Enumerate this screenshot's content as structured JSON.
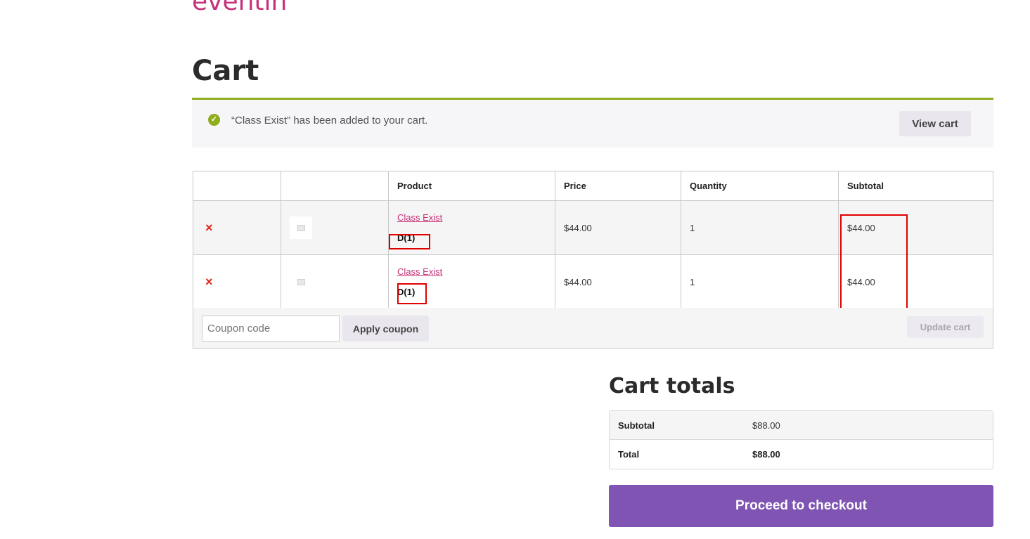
{
  "site": {
    "title": "eventin"
  },
  "page": {
    "title": "Cart"
  },
  "notice": {
    "message": "“Class Exist” has been added to your cart.",
    "view_cart_label": "View cart",
    "icon": "check-circle-icon",
    "accent_color": "#8fae1b"
  },
  "cart": {
    "headers": {
      "remove": "",
      "thumbnail": "",
      "product": "Product",
      "price": "Price",
      "quantity": "Quantity",
      "subtotal": "Subtotal"
    },
    "items": [
      {
        "remove": "×",
        "name": "Class Exist",
        "meta": "D(1)",
        "price": "$44.00",
        "quantity": "1",
        "subtotal": "$44.00"
      },
      {
        "remove": "×",
        "name": "Class Exist",
        "meta": "D(1)",
        "price": "$44.00",
        "quantity": "1",
        "subtotal": "$44.00"
      }
    ]
  },
  "actions": {
    "coupon_placeholder": "Coupon code",
    "apply_coupon_label": "Apply coupon",
    "update_cart_label": "Update cart"
  },
  "totals": {
    "title": "Cart totals",
    "subtotal_label": "Subtotal",
    "subtotal_value": "$88.00",
    "total_label": "Total",
    "total_value": "$88.00"
  },
  "checkout": {
    "label": "Proceed to checkout",
    "color": "#7f54b3"
  },
  "brand_color": "#c7317a"
}
